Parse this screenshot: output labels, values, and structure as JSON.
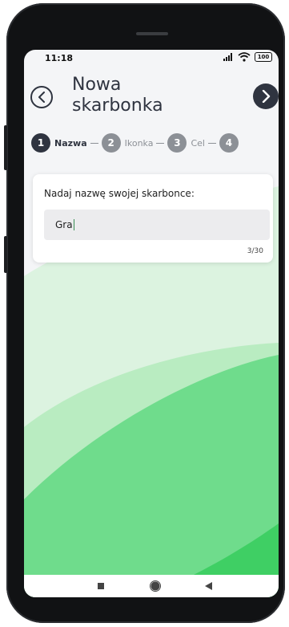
{
  "status_bar": {
    "time": "11:18",
    "battery": "100"
  },
  "header": {
    "title_line1": "Nowa",
    "title_line2": "skarbonka",
    "back_icon": "chevron-left-circle-icon",
    "next_icon": "chevron-right-circle-icon"
  },
  "stepper": {
    "steps": [
      {
        "number": "1",
        "label": "Nazwa",
        "active": true
      },
      {
        "number": "2",
        "label": "Ikonka",
        "active": false
      },
      {
        "number": "3",
        "label": "Cel",
        "active": false
      },
      {
        "number": "4",
        "label": "",
        "active": false
      }
    ]
  },
  "name_card": {
    "label": "Nadaj nazwę swojej skarbonce:",
    "input_value": "Gra",
    "counter": "3/30"
  },
  "colors": {
    "dark": "#2f3440",
    "inactive_step": "#8c9096",
    "green_light": "#dcf3e0",
    "green_mid": "#b9ecc1",
    "green_strong": "#6fdc8c"
  },
  "nav_bar": {
    "items": [
      "recent-apps-icon",
      "home-icon",
      "back-icon"
    ]
  }
}
